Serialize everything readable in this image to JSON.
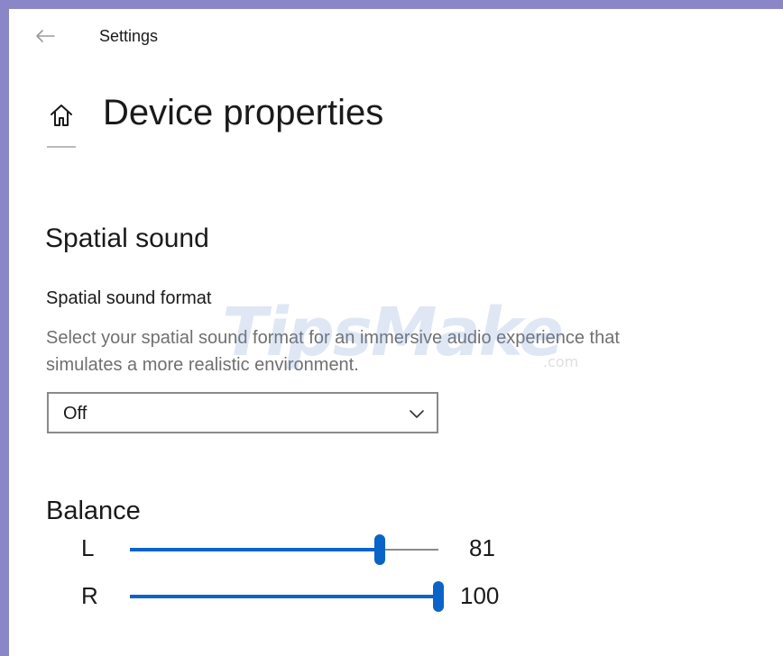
{
  "window": {
    "title": "Settings"
  },
  "header": {
    "back_icon": "arrow-left-icon",
    "home_icon": "home-icon",
    "page_title": "Device properties"
  },
  "spatial_sound": {
    "section_title": "Spatial sound",
    "format_label": "Spatial sound format",
    "format_description": "Select your spatial sound format for an immersive audio experience that simulates a more realistic environment.",
    "format_value": "Off",
    "dropdown_icon": "chevron-down-icon"
  },
  "balance": {
    "title": "Balance",
    "channels": [
      {
        "label": "L",
        "value": 81,
        "display": "81"
      },
      {
        "label": "R",
        "value": 100,
        "display": "100"
      }
    ],
    "accent_color": "#0a64c8"
  },
  "watermark": {
    "text": "TipsMake",
    "suffix": ".com"
  }
}
